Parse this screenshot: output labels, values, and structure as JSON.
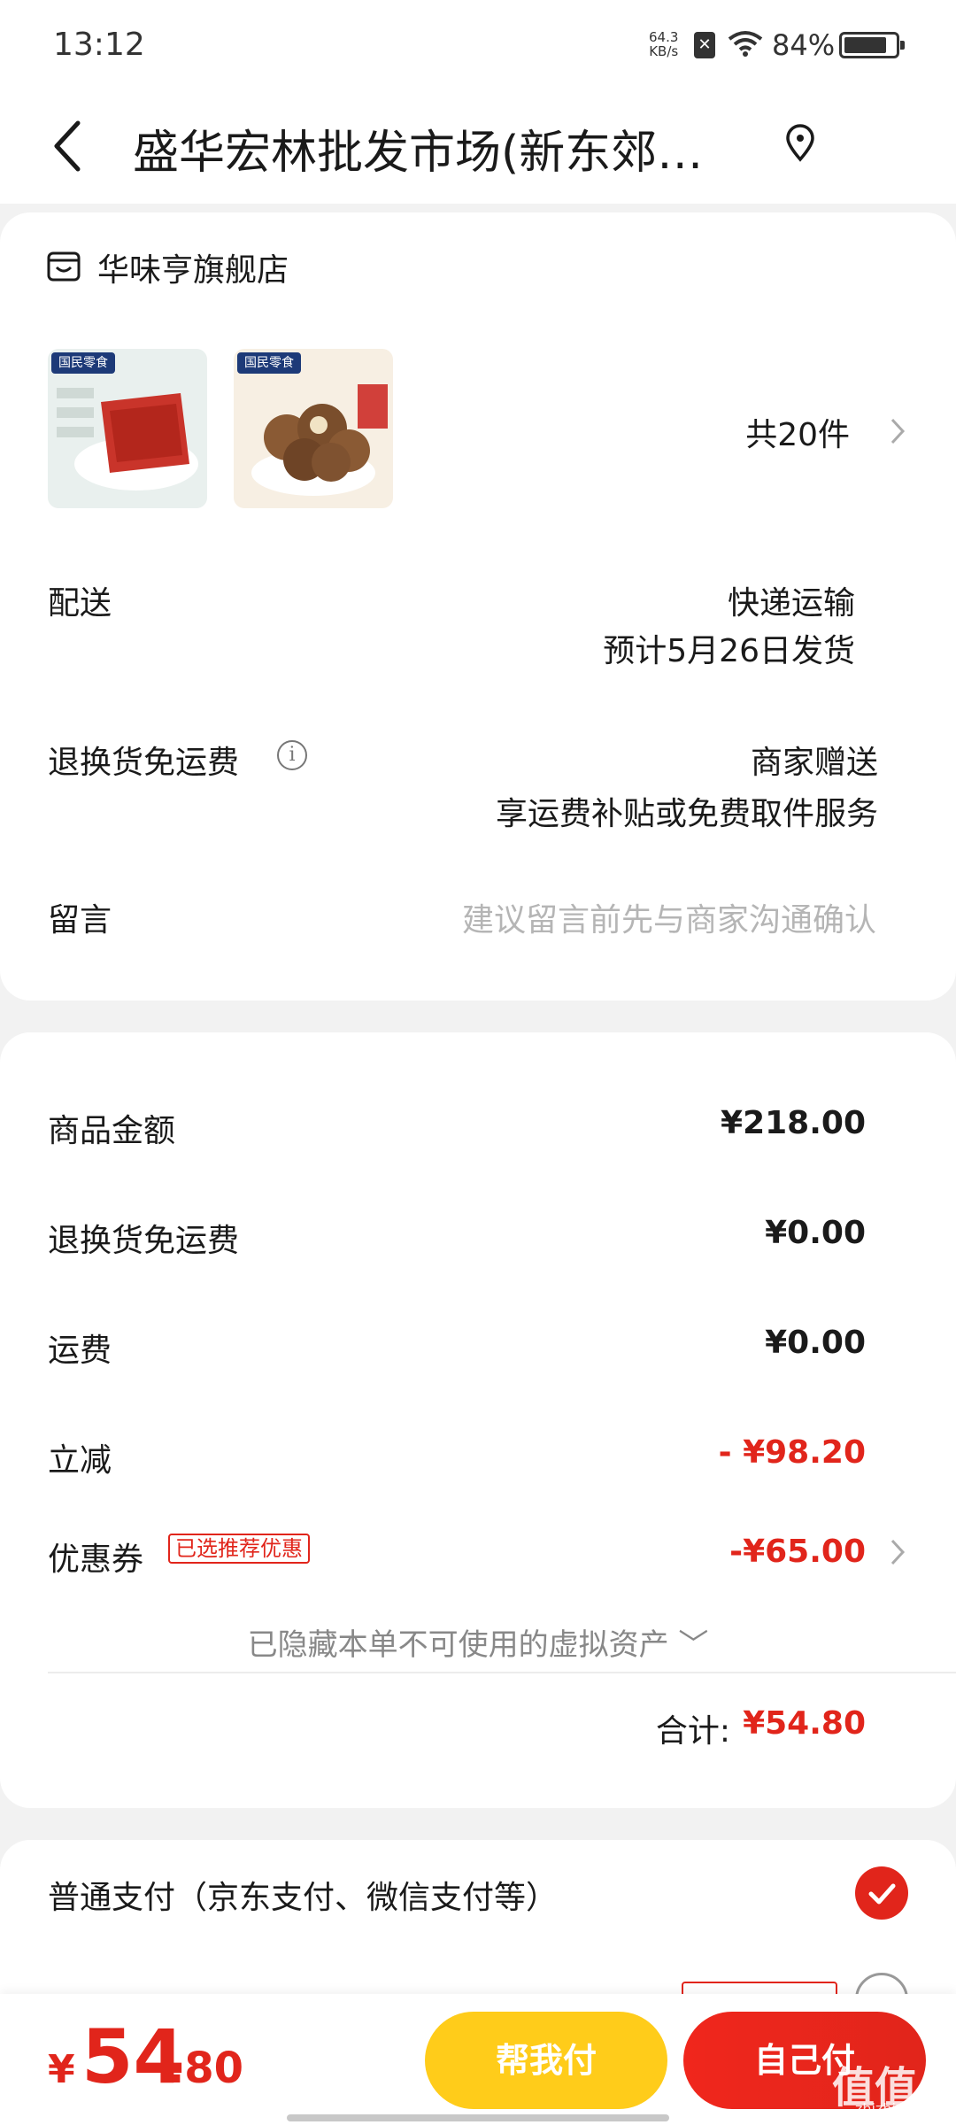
{
  "status_bar": {
    "time": "13:12",
    "net_speed_value": "64.3",
    "net_speed_unit": "KB/s",
    "battery": "84%",
    "battery_level": 0.84
  },
  "nav": {
    "title": "盛华宏林批发市场(新东郊…"
  },
  "order": {
    "shop_name": "华味亨旗舰店",
    "product_badge": "国民零食",
    "item_count": "共20件",
    "delivery_label": "配送",
    "delivery_method": "快递运输",
    "delivery_eta": "预计5月26日发货",
    "return_label": "退换货免运费",
    "return_value": "商家赠送",
    "return_desc": "享运费补贴或免费取件服务",
    "note_label": "留言",
    "note_placeholder": "建议留言前先与商家沟通确认"
  },
  "summary": {
    "goods_label": "商品金额",
    "goods_value": "¥218.00",
    "return_fee_label": "退换货免运费",
    "return_fee_value": "¥0.00",
    "shipping_label": "运费",
    "shipping_value": "¥0.00",
    "discount_label": "立减",
    "discount_value": "- ¥98.20",
    "coupon_label": "优惠券",
    "coupon_tag": "已选推荐优惠",
    "coupon_value": "-¥65.00",
    "hidden_note": "已隐藏本单不可使用的虚拟资产 ﹀",
    "total_label": "合计:",
    "total_value": "¥54.80"
  },
  "payment": {
    "method_label": "普通支付（京东支付、微信支付等）"
  },
  "bottom": {
    "price_yen": "¥",
    "price_int": "54",
    "price_dec": ".80",
    "help_pay": "帮我付",
    "self_pay": "自己付",
    "watermark": "值值值",
    "watermark_sub": "zhizhizhi.com"
  },
  "colors": {
    "accent": "#e1251b",
    "help_button": "#ffcc1a"
  }
}
